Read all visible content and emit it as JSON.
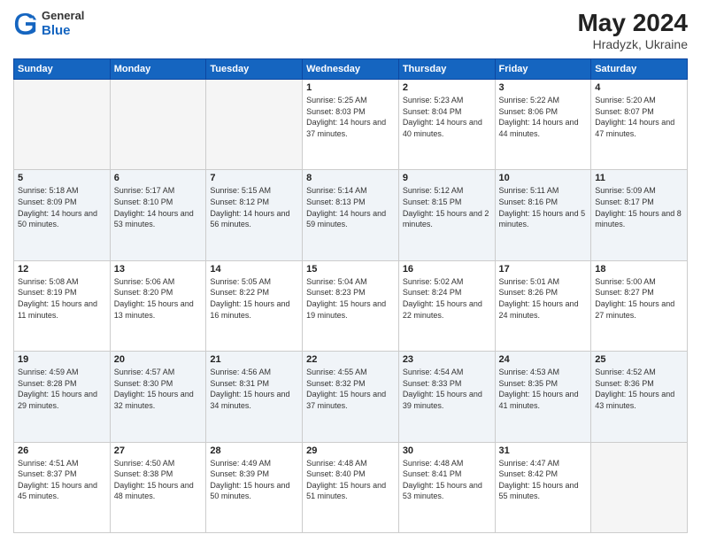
{
  "header": {
    "logo_general": "General",
    "logo_blue": "Blue",
    "month_year": "May 2024",
    "location": "Hradyzk, Ukraine"
  },
  "weekdays": [
    "Sunday",
    "Monday",
    "Tuesday",
    "Wednesday",
    "Thursday",
    "Friday",
    "Saturday"
  ],
  "weeks": [
    [
      {
        "day": "",
        "sunrise": "",
        "sunset": "",
        "daylight": ""
      },
      {
        "day": "",
        "sunrise": "",
        "sunset": "",
        "daylight": ""
      },
      {
        "day": "",
        "sunrise": "",
        "sunset": "",
        "daylight": ""
      },
      {
        "day": "1",
        "sunrise": "Sunrise: 5:25 AM",
        "sunset": "Sunset: 8:03 PM",
        "daylight": "Daylight: 14 hours and 37 minutes."
      },
      {
        "day": "2",
        "sunrise": "Sunrise: 5:23 AM",
        "sunset": "Sunset: 8:04 PM",
        "daylight": "Daylight: 14 hours and 40 minutes."
      },
      {
        "day": "3",
        "sunrise": "Sunrise: 5:22 AM",
        "sunset": "Sunset: 8:06 PM",
        "daylight": "Daylight: 14 hours and 44 minutes."
      },
      {
        "day": "4",
        "sunrise": "Sunrise: 5:20 AM",
        "sunset": "Sunset: 8:07 PM",
        "daylight": "Daylight: 14 hours and 47 minutes."
      }
    ],
    [
      {
        "day": "5",
        "sunrise": "Sunrise: 5:18 AM",
        "sunset": "Sunset: 8:09 PM",
        "daylight": "Daylight: 14 hours and 50 minutes."
      },
      {
        "day": "6",
        "sunrise": "Sunrise: 5:17 AM",
        "sunset": "Sunset: 8:10 PM",
        "daylight": "Daylight: 14 hours and 53 minutes."
      },
      {
        "day": "7",
        "sunrise": "Sunrise: 5:15 AM",
        "sunset": "Sunset: 8:12 PM",
        "daylight": "Daylight: 14 hours and 56 minutes."
      },
      {
        "day": "8",
        "sunrise": "Sunrise: 5:14 AM",
        "sunset": "Sunset: 8:13 PM",
        "daylight": "Daylight: 14 hours and 59 minutes."
      },
      {
        "day": "9",
        "sunrise": "Sunrise: 5:12 AM",
        "sunset": "Sunset: 8:15 PM",
        "daylight": "Daylight: 15 hours and 2 minutes."
      },
      {
        "day": "10",
        "sunrise": "Sunrise: 5:11 AM",
        "sunset": "Sunset: 8:16 PM",
        "daylight": "Daylight: 15 hours and 5 minutes."
      },
      {
        "day": "11",
        "sunrise": "Sunrise: 5:09 AM",
        "sunset": "Sunset: 8:17 PM",
        "daylight": "Daylight: 15 hours and 8 minutes."
      }
    ],
    [
      {
        "day": "12",
        "sunrise": "Sunrise: 5:08 AM",
        "sunset": "Sunset: 8:19 PM",
        "daylight": "Daylight: 15 hours and 11 minutes."
      },
      {
        "day": "13",
        "sunrise": "Sunrise: 5:06 AM",
        "sunset": "Sunset: 8:20 PM",
        "daylight": "Daylight: 15 hours and 13 minutes."
      },
      {
        "day": "14",
        "sunrise": "Sunrise: 5:05 AM",
        "sunset": "Sunset: 8:22 PM",
        "daylight": "Daylight: 15 hours and 16 minutes."
      },
      {
        "day": "15",
        "sunrise": "Sunrise: 5:04 AM",
        "sunset": "Sunset: 8:23 PM",
        "daylight": "Daylight: 15 hours and 19 minutes."
      },
      {
        "day": "16",
        "sunrise": "Sunrise: 5:02 AM",
        "sunset": "Sunset: 8:24 PM",
        "daylight": "Daylight: 15 hours and 22 minutes."
      },
      {
        "day": "17",
        "sunrise": "Sunrise: 5:01 AM",
        "sunset": "Sunset: 8:26 PM",
        "daylight": "Daylight: 15 hours and 24 minutes."
      },
      {
        "day": "18",
        "sunrise": "Sunrise: 5:00 AM",
        "sunset": "Sunset: 8:27 PM",
        "daylight": "Daylight: 15 hours and 27 minutes."
      }
    ],
    [
      {
        "day": "19",
        "sunrise": "Sunrise: 4:59 AM",
        "sunset": "Sunset: 8:28 PM",
        "daylight": "Daylight: 15 hours and 29 minutes."
      },
      {
        "day": "20",
        "sunrise": "Sunrise: 4:57 AM",
        "sunset": "Sunset: 8:30 PM",
        "daylight": "Daylight: 15 hours and 32 minutes."
      },
      {
        "day": "21",
        "sunrise": "Sunrise: 4:56 AM",
        "sunset": "Sunset: 8:31 PM",
        "daylight": "Daylight: 15 hours and 34 minutes."
      },
      {
        "day": "22",
        "sunrise": "Sunrise: 4:55 AM",
        "sunset": "Sunset: 8:32 PM",
        "daylight": "Daylight: 15 hours and 37 minutes."
      },
      {
        "day": "23",
        "sunrise": "Sunrise: 4:54 AM",
        "sunset": "Sunset: 8:33 PM",
        "daylight": "Daylight: 15 hours and 39 minutes."
      },
      {
        "day": "24",
        "sunrise": "Sunrise: 4:53 AM",
        "sunset": "Sunset: 8:35 PM",
        "daylight": "Daylight: 15 hours and 41 minutes."
      },
      {
        "day": "25",
        "sunrise": "Sunrise: 4:52 AM",
        "sunset": "Sunset: 8:36 PM",
        "daylight": "Daylight: 15 hours and 43 minutes."
      }
    ],
    [
      {
        "day": "26",
        "sunrise": "Sunrise: 4:51 AM",
        "sunset": "Sunset: 8:37 PM",
        "daylight": "Daylight: 15 hours and 45 minutes."
      },
      {
        "day": "27",
        "sunrise": "Sunrise: 4:50 AM",
        "sunset": "Sunset: 8:38 PM",
        "daylight": "Daylight: 15 hours and 48 minutes."
      },
      {
        "day": "28",
        "sunrise": "Sunrise: 4:49 AM",
        "sunset": "Sunset: 8:39 PM",
        "daylight": "Daylight: 15 hours and 50 minutes."
      },
      {
        "day": "29",
        "sunrise": "Sunrise: 4:48 AM",
        "sunset": "Sunset: 8:40 PM",
        "daylight": "Daylight: 15 hours and 51 minutes."
      },
      {
        "day": "30",
        "sunrise": "Sunrise: 4:48 AM",
        "sunset": "Sunset: 8:41 PM",
        "daylight": "Daylight: 15 hours and 53 minutes."
      },
      {
        "day": "31",
        "sunrise": "Sunrise: 4:47 AM",
        "sunset": "Sunset: 8:42 PM",
        "daylight": "Daylight: 15 hours and 55 minutes."
      },
      {
        "day": "",
        "sunrise": "",
        "sunset": "",
        "daylight": ""
      }
    ]
  ]
}
